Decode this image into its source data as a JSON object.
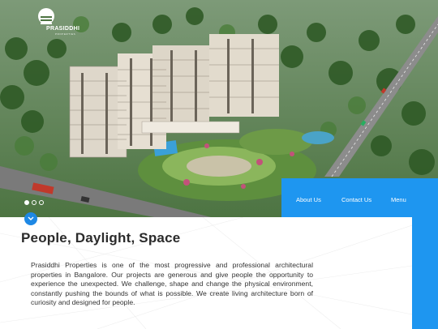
{
  "brand": {
    "name": "PRASIDDHI",
    "tagline": "PROPERTIES"
  },
  "nav": {
    "items": [
      {
        "label": "About Us"
      },
      {
        "label": "Contact Us"
      },
      {
        "label": "Menu"
      }
    ]
  },
  "carousel": {
    "slide_count": 3,
    "active_index": 0
  },
  "hero_content": {
    "headline": "People, Daylight, Space",
    "description": "Prasiddhi Properties is one of the most progressive and professional architectural properties in Bangalore. Our projects are generous and give people the opportunity to experience the unexpected. We challenge, shape and change the physical environment, constantly pushing the bounds of what is possible. We create living architecture born of curiosity and designed for people."
  },
  "colors": {
    "accent": "#1e96f0",
    "button": "#1e88e5",
    "headline": "#2b2b2b",
    "body_text": "#333333"
  },
  "icons": {
    "scroll": "chevron-down-icon",
    "logo": "sun-building-logo-icon"
  }
}
